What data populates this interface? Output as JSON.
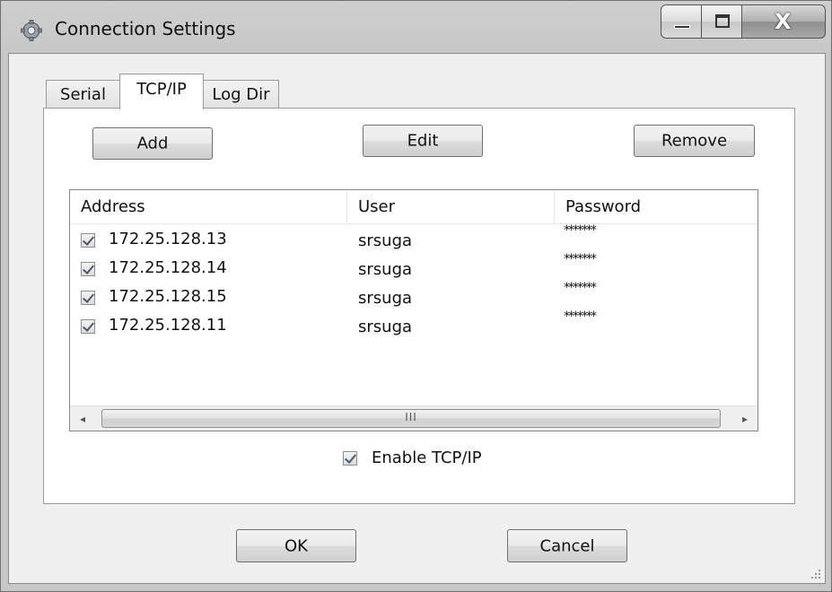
{
  "window": {
    "title": "Connection Settings",
    "controls": {
      "close_glyph": "X"
    }
  },
  "tabs": [
    {
      "label": "Serial",
      "active": false
    },
    {
      "label": "TCP/IP",
      "active": true
    },
    {
      "label": "Log Dir",
      "active": false
    }
  ],
  "toolbar": {
    "add_label": "Add",
    "edit_label": "Edit",
    "remove_label": "Remove"
  },
  "list": {
    "columns": [
      "Address",
      "User",
      "Password"
    ],
    "rows": [
      {
        "checked": true,
        "address": "172.25.128.13",
        "user": "srsuga",
        "password": "*******"
      },
      {
        "checked": true,
        "address": "172.25.128.14",
        "user": "srsuga",
        "password": "*******"
      },
      {
        "checked": true,
        "address": "172.25.128.15",
        "user": "srsuga",
        "password": "*******"
      },
      {
        "checked": true,
        "address": "172.25.128.11",
        "user": "srsuga",
        "password": "*******"
      }
    ],
    "scrollbar": {
      "left_glyph": "◂",
      "right_glyph": "▸",
      "grip": "III"
    }
  },
  "enable_tcpip": {
    "label": "Enable TCP/IP",
    "checked": true
  },
  "footer": {
    "ok_label": "OK",
    "cancel_label": "Cancel"
  },
  "icons": {
    "title": "gear-icon",
    "minimize": "minimize-icon",
    "maximize": "maximize-icon",
    "close": "close-icon"
  }
}
